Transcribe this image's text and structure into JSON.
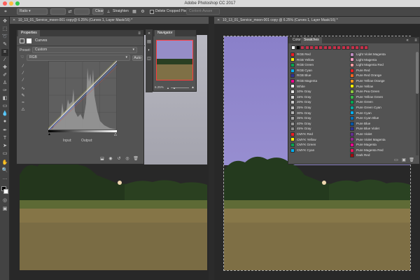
{
  "window": {
    "title": "Adobe Photoshop CC 2017"
  },
  "options_bar": {
    "ratio_label": "Ratio",
    "clear_label": "Clear",
    "straighten_label": "Straighten",
    "delete_cropped_label": "Delete Cropped Pixels",
    "content_aware_label": "Content-Aware"
  },
  "documents": [
    {
      "tab": "10_13_01_Service_moon-001 copy@ 6.25% (Curves 1, Layer Mask/16) *"
    },
    {
      "tab": "10_13_01_Service_moon-001 copy @ 6.25% (Curves 1, Layer Mask/16) *"
    }
  ],
  "properties": {
    "tab": "Properties",
    "title": "Curves",
    "preset_label": "Preset:",
    "preset_value": "Custom",
    "channel_value": "RGB",
    "auto_label": "Auto",
    "input_label": "Input:",
    "output_label": "Output:"
  },
  "navigator": {
    "tab": "Navigator",
    "zoom": "6.25%"
  },
  "color_panel": {
    "tab_color": "Color",
    "tab_swatches": "Swatches",
    "left_swatches": [
      {
        "name": "RGB Red",
        "color": "#ee1c24"
      },
      {
        "name": "RGB Yellow",
        "color": "#fff200"
      },
      {
        "name": "RGB Green",
        "color": "#00a650"
      },
      {
        "name": "RGB Cyan",
        "color": "#00aeef"
      },
      {
        "name": "RGB Blue",
        "color": "#2e3192"
      },
      {
        "name": "RGB Magenta",
        "color": "#ec008c"
      },
      {
        "name": "White",
        "color": "#ffffff"
      },
      {
        "name": "10% Gray",
        "color": "#e6e6e6"
      },
      {
        "name": "15% Gray",
        "color": "#d9d9d9"
      },
      {
        "name": "20% Gray",
        "color": "#cccccc"
      },
      {
        "name": "25% Gray",
        "color": "#bfbfbf"
      },
      {
        "name": "30% Gray",
        "color": "#b3b3b3"
      },
      {
        "name": "35% Gray",
        "color": "#a6a6a6"
      },
      {
        "name": "40% Gray",
        "color": "#999999"
      },
      {
        "name": "45% Gray",
        "color": "#8c8c8c"
      },
      {
        "name": "CMYK Red",
        "color": "#ed1c24"
      },
      {
        "name": "CMYK Yellow",
        "color": "#fff200"
      },
      {
        "name": "CMYK Green",
        "color": "#00a651"
      },
      {
        "name": "CMYK Cyan",
        "color": "#00aeef"
      }
    ],
    "right_swatches": [
      {
        "name": "Light Violet Magenta",
        "color": "#bd8cbf"
      },
      {
        "name": "Light Magenta",
        "color": "#f49ac1"
      },
      {
        "name": "Light Magenta Red",
        "color": "#f5989d"
      },
      {
        "name": "Pure Red",
        "color": "#ed1c24"
      },
      {
        "name": "Pure Red Orange",
        "color": "#f26522"
      },
      {
        "name": "Pure Yellow Orange",
        "color": "#f7941d"
      },
      {
        "name": "Pure Yellow",
        "color": "#fff200"
      },
      {
        "name": "Pure Pea Green",
        "color": "#8dc63f"
      },
      {
        "name": "Pure Yellow Green",
        "color": "#39b54a"
      },
      {
        "name": "Pure Green",
        "color": "#00a651"
      },
      {
        "name": "Pure Green Cyan",
        "color": "#00a99d"
      },
      {
        "name": "Pure Cyan",
        "color": "#00aeef"
      },
      {
        "name": "Pure Cyan Blue",
        "color": "#0072bc"
      },
      {
        "name": "Pure Blue",
        "color": "#0054a6"
      },
      {
        "name": "Pure Blue Violet",
        "color": "#2e3192"
      },
      {
        "name": "Pure Violet",
        "color": "#662d91"
      },
      {
        "name": "Pure Violet Magenta",
        "color": "#92278f"
      },
      {
        "name": "Pure Magenta",
        "color": "#ec008c"
      },
      {
        "name": "Pure Magenta Red",
        "color": "#ed145b"
      },
      {
        "name": "Dark Red",
        "color": "#9e0b0f"
      }
    ],
    "recent_colors": [
      "#ffffff",
      "#000000",
      "#c5314a",
      "#c5314a",
      "#c5314a",
      "#c5314a",
      "#c5314a",
      "#c5314a",
      "#c5314a",
      "#c5314a",
      "#c5314a",
      "#c5314a",
      "#c5314a",
      "#c5314a",
      "#c5314a",
      "#c5314a",
      "#c5314a"
    ]
  },
  "colors": {
    "chrome": "#535353",
    "sky_left": "#a9a9b3",
    "sky_right": "#8e86c6",
    "field": "#7d6e45",
    "trees": "#253b1f"
  }
}
